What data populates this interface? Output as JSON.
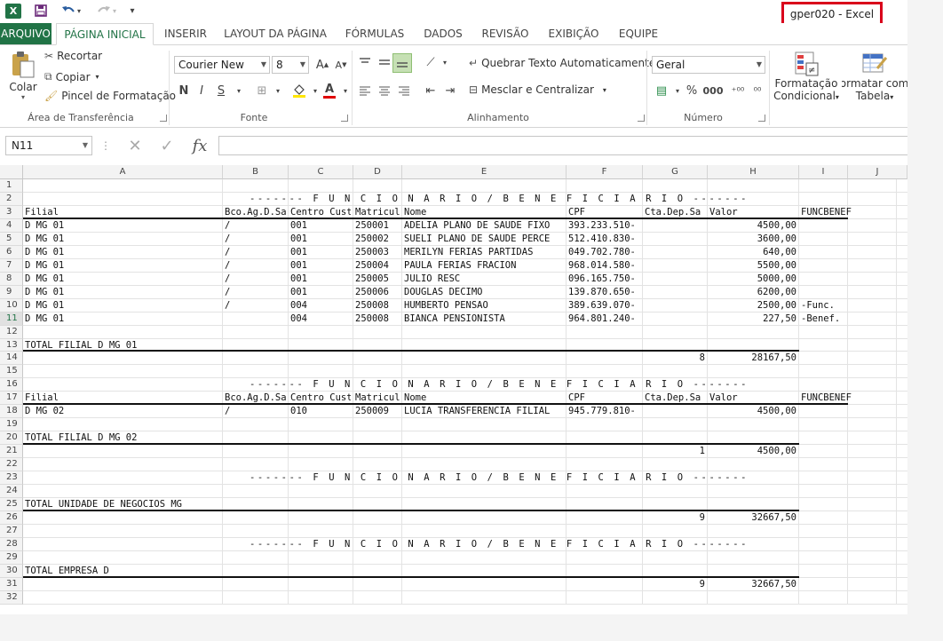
{
  "window": {
    "title": "gper020 - Excel",
    "app_icon_label": "X",
    "qat": {
      "save_icon": "save-icon",
      "undo_icon": "undo-icon",
      "redo_icon": "redo-icon",
      "customize_icon": "customize-qat-icon"
    }
  },
  "tabs": [
    "ARQUIVO",
    "PÁGINA INICIAL",
    "INSERIR",
    "LAYOUT DA PÁGINA",
    "FÓRMULAS",
    "DADOS",
    "REVISÃO",
    "EXIBIÇÃO",
    "EQUIPE"
  ],
  "ribbon": {
    "clipboard": {
      "paste": "Colar",
      "cut": "Recortar",
      "copy": "Copiar",
      "format_painter": "Pincel de Formatação",
      "label": "Área de Transferência"
    },
    "font": {
      "name": "Courier New",
      "size": "8",
      "bold": "N",
      "italic": "I",
      "underline": "S",
      "label": "Fonte",
      "grow": "A",
      "shrink": "A",
      "font_color_glyph": "A"
    },
    "alignment": {
      "wrap": "Quebrar Texto Automaticamente",
      "merge": "Mesclar e Centralizar",
      "label": "Alinhamento"
    },
    "number": {
      "format": "Geral",
      "label": "Número",
      "percent": "%",
      "thousands": "000",
      "inc_decimal": "⁺⁰⁰",
      "dec_decimal": "⁰⁰"
    },
    "styles": {
      "conditional_line1": "Formatação",
      "conditional_line2": "Condicional",
      "table_line1": "Formatar como",
      "table_line2": "Tabela"
    }
  },
  "formula_bar": {
    "name_box": "N11",
    "formula": "",
    "fx": "fx"
  },
  "sheet": {
    "columns": [
      "A",
      "B",
      "C",
      "D",
      "E",
      "F",
      "G",
      "H",
      "I",
      "J"
    ],
    "rows": [
      "1",
      "2",
      "3",
      "4",
      "5",
      "6",
      "7",
      "8",
      "9",
      "10",
      "11",
      "12",
      "13",
      "14",
      "15",
      "16",
      "17",
      "18",
      "19",
      "20",
      "21",
      "22",
      "23",
      "24",
      "25",
      "26",
      "27",
      "28",
      "29",
      "30",
      "31",
      "32"
    ],
    "selected_row": "11",
    "section_title": "------- F U N C I O N A R I O / B E N E F I C I A R I O -------",
    "headers": [
      "Filial",
      "Bco.Ag.D.Sa",
      "Centro Cust",
      "Matricul",
      "Nome",
      "CPF",
      "Cta.Dep.Sa",
      "Valor",
      "FUNCBENEF"
    ],
    "block1": [
      [
        "D MG 01",
        "/",
        "001",
        "250001",
        "ADELIA PLANO DE SAUDE FIXO",
        "393.233.510-",
        "",
        "4500,00",
        ""
      ],
      [
        "D MG 01",
        "/",
        "001",
        "250002",
        "SUELI PLANO DE SAUDE PERCE",
        "512.410.830-",
        "",
        "3600,00",
        ""
      ],
      [
        "D MG 01",
        "/",
        "001",
        "250003",
        "MERILYN FERIAS PARTIDAS",
        "049.702.780-",
        "",
        "640,00",
        ""
      ],
      [
        "D MG 01",
        "/",
        "001",
        "250004",
        "PAULA FERIAS FRACION",
        "968.014.580-",
        "",
        "5500,00",
        ""
      ],
      [
        "D MG 01",
        "/",
        "001",
        "250005",
        "JULIO RESC",
        "096.165.750-",
        "",
        "5000,00",
        ""
      ],
      [
        "D MG 01",
        "/",
        "001",
        "250006",
        "DOUGLAS DECIMO",
        "139.870.650-",
        "",
        "6200,00",
        ""
      ],
      [
        "D MG 01",
        "/",
        "004",
        "250008",
        "HUMBERTO PENSAO",
        "389.639.070-",
        "",
        "2500,00",
        "-Func."
      ],
      [
        "D MG 01",
        "",
        "004",
        "250008",
        "BIANCA PENSIONISTA",
        "964.801.240-",
        "",
        "227,50",
        "-Benef."
      ]
    ],
    "total_filial_1": {
      "label": "TOTAL FILIAL D MG 01",
      "count": "8",
      "value": "28167,50"
    },
    "block2": [
      [
        "D MG 02",
        "/",
        "010",
        "250009",
        "LUCIA TRANSFERENCIA FILIAL",
        "945.779.810-",
        "",
        "4500,00",
        ""
      ]
    ],
    "total_filial_2": {
      "label": "TOTAL FILIAL D MG 02",
      "count": "1",
      "value": "4500,00"
    },
    "total_unidade": {
      "label": "TOTAL UNIDADE DE NEGOCIOS  MG",
      "count": "9",
      "value": "32667,50"
    },
    "total_empresa": {
      "label": "TOTAL EMPRESA  D",
      "count": "9",
      "value": "32667,50"
    }
  }
}
